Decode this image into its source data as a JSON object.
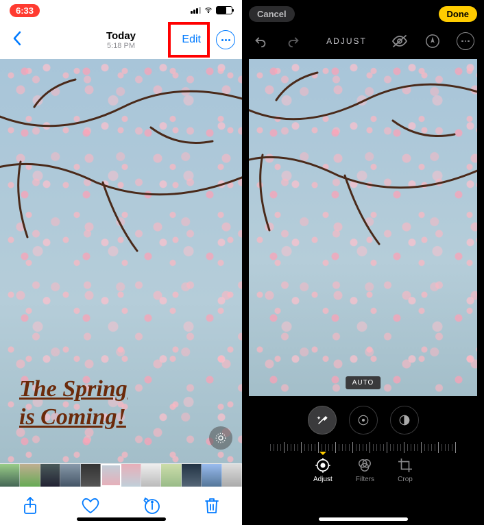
{
  "left": {
    "statusbar": {
      "time": "6:33"
    },
    "nav": {
      "title": "Today",
      "subtitle": "5:18 PM",
      "edit_label": "Edit"
    },
    "watermark_line1": "The Spring",
    "watermark_line2": "is Coming!"
  },
  "right": {
    "nav": {
      "cancel_label": "Cancel",
      "done_label": "Done"
    },
    "mode_title": "ADJUST",
    "auto_label": "AUTO",
    "tabs": {
      "adjust": "Adjust",
      "filters": "Filters",
      "crop": "Crop"
    }
  }
}
